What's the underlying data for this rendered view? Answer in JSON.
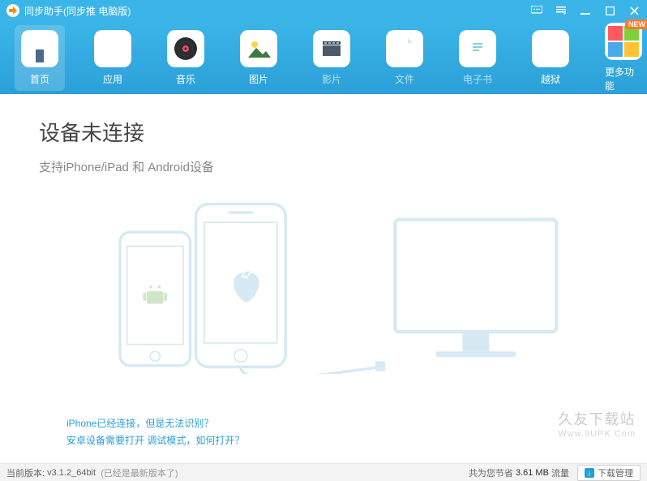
{
  "titlebar": {
    "title": "同步助手(同步推 电脑版)"
  },
  "toolbar": {
    "tabs": [
      {
        "label": "首页"
      },
      {
        "label": "应用"
      },
      {
        "label": "音乐"
      },
      {
        "label": "图片"
      },
      {
        "label": "影片"
      },
      {
        "label": "文件"
      },
      {
        "label": "电子书"
      },
      {
        "label": "越狱"
      },
      {
        "label": "更多功能",
        "badge": "NEW"
      }
    ]
  },
  "main": {
    "heading": "设备未连接",
    "subtitle": "支持iPhone/iPad 和 Android设备",
    "links": [
      "iPhone已经连接，但是无法识别？",
      "安卓设备需要打开 调试模式，如何打开？"
    ]
  },
  "watermark": {
    "line1": "久友下载站",
    "line2": "Www.9UPK.Com"
  },
  "statusbar": {
    "version_label": "当前版本:",
    "version_value": "v3.1.2_64bit",
    "version_note": "(已经是最新版本了)",
    "saved_prefix": "共为您节省",
    "saved_amount": "3.61 MB",
    "saved_suffix": "流量",
    "download_mgr": "下载管理"
  }
}
